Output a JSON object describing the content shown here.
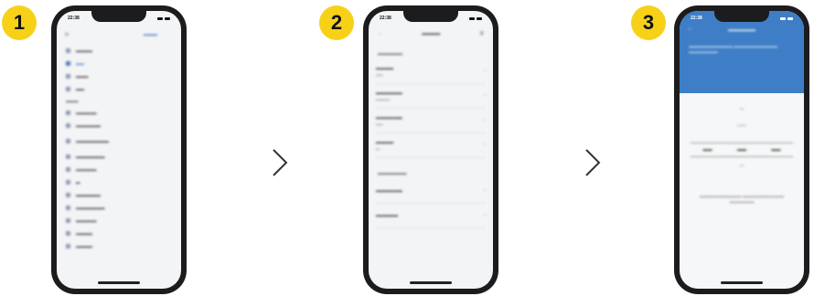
{
  "steps": [
    {
      "number": "1"
    },
    {
      "number": "2"
    },
    {
      "number": "3"
    }
  ],
  "status_time": "22:38",
  "badge_color": "#f7d118",
  "accent_color": "#3d7ec6",
  "icons": {
    "chevron": "chevron-right-icon",
    "back": "arrow-left-icon",
    "close": "close-icon"
  }
}
